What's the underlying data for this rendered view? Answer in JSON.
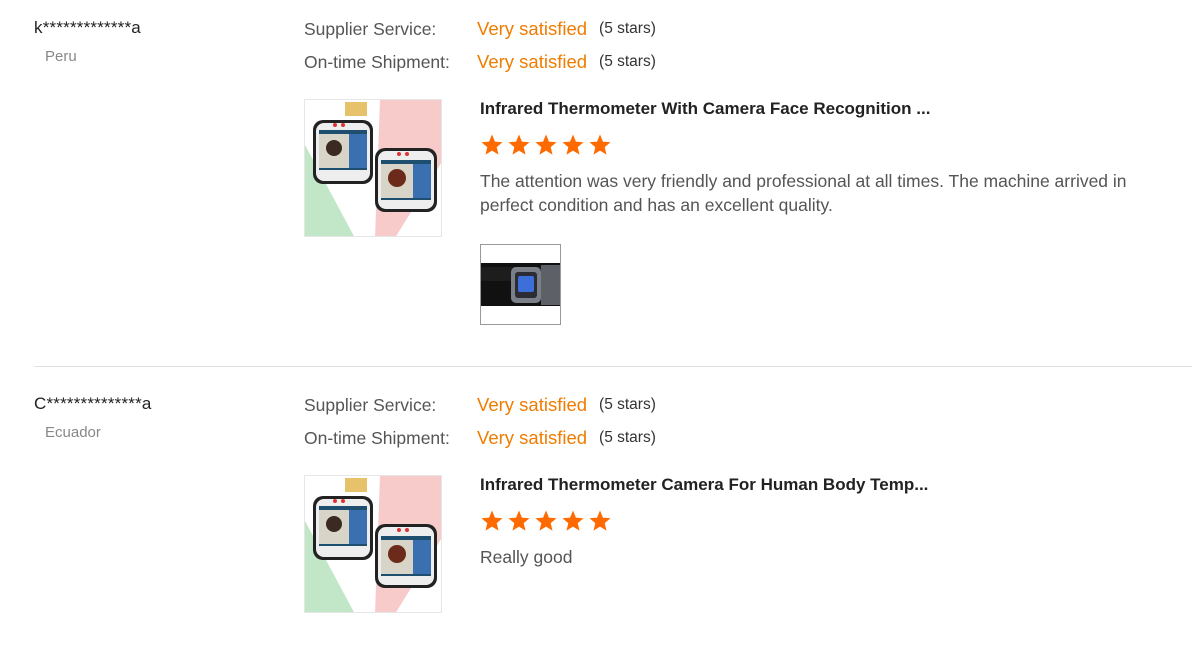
{
  "reviews": [
    {
      "buyer_name": "k*************a",
      "country": "Peru",
      "ratings": [
        {
          "label": "Supplier Service:",
          "value": "Very satisfied",
          "stars_text": "(5 stars)"
        },
        {
          "label": "On-time Shipment:",
          "value": "Very satisfied",
          "stars_text": "(5 stars)"
        }
      ],
      "product_title": "Infrared Thermometer With Camera Face Recognition ...",
      "product_image_icon": "thermometer-camera-product-image",
      "star_rating": 5,
      "review_text": "The attention was very friendly and professional at all times. The machine arrived in perfect condition and has an excellent quality.",
      "photo_icon": "customer-photo"
    },
    {
      "buyer_name": "C**************a",
      "country": "Ecuador",
      "ratings": [
        {
          "label": "Supplier Service:",
          "value": "Very satisfied",
          "stars_text": "(5 stars)"
        },
        {
          "label": "On-time Shipment:",
          "value": "Very satisfied",
          "stars_text": "(5 stars)"
        }
      ],
      "product_title": "Infrared Thermometer Camera For Human Body Temp...",
      "product_image_icon": "thermometer-camera-product-image",
      "star_rating": 5,
      "review_text": "Really good"
    }
  ],
  "colors": {
    "accent": "#f07c00",
    "star": "#ff6a00",
    "muted_text": "#888888",
    "divider": "#e2e2e2"
  }
}
